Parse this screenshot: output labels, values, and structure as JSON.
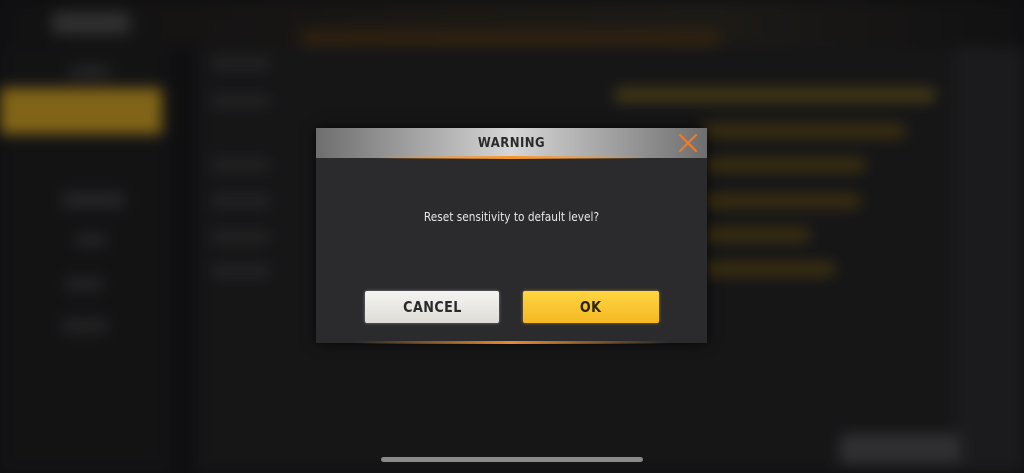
{
  "dialog": {
    "title": "WARNING",
    "message": "Reset sensitivity to default level?",
    "cancel_label": "CANCEL",
    "ok_label": "OK",
    "close_icon": "close-icon"
  },
  "colors": {
    "accent_orange": "#f07a2a",
    "ok_yellow": "#f9c630",
    "cancel_white": "#ecebe7",
    "dialog_bg": "#2b2b2d",
    "header_silver": "#d6d6d6"
  }
}
